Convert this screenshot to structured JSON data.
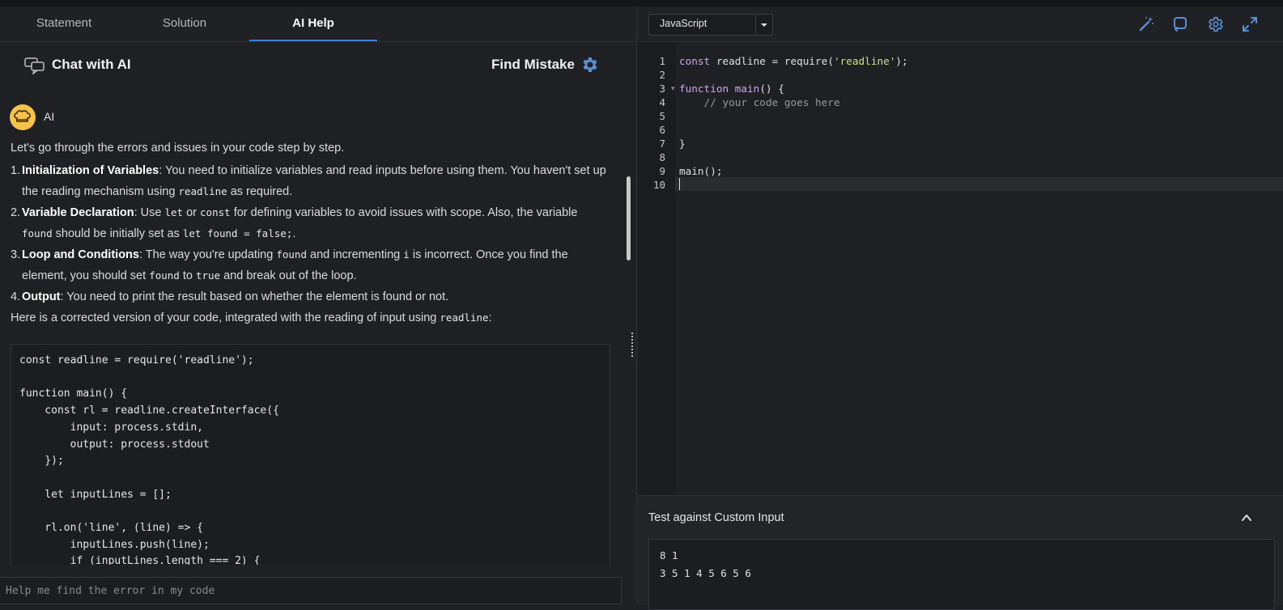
{
  "tabs": [
    {
      "label": "Statement"
    },
    {
      "label": "Solution"
    },
    {
      "label": "AI Help"
    }
  ],
  "chat": {
    "title": "Chat with AI",
    "find_mistake": "Find Mistake",
    "sender": "AI",
    "intro": "Let's go through the errors and issues in your code step by step.",
    "items": [
      {
        "num": "1.",
        "title": "Initialization of Variables",
        "t1": ": You need to initialize variables and read inputs before using them. You haven't set up the reading mechanism using ",
        "c1": "readline",
        "t2": " as required."
      },
      {
        "num": "2.",
        "title": "Variable Declaration",
        "t1": ": Use ",
        "c1": "let",
        "t2": " or ",
        "c2": "const",
        "t3": " for defining variables to avoid issues with scope. Also, the variable ",
        "c3": "found",
        "t4": " should be initially set as ",
        "c4": "let found = false;",
        "t5": "."
      },
      {
        "num": "3.",
        "title": "Loop and Conditions",
        "t1": ": The way you're updating ",
        "c1": "found",
        "t2": " and incrementing ",
        "c2": "i",
        "t3": " is incorrect. Once you find the element, you should set ",
        "c3": "found",
        "t4": " to ",
        "c4": "true",
        "t5": " and break out of the loop."
      },
      {
        "num": "4.",
        "title": "Output",
        "t1": ": You need to print the result based on whether the element is found or not."
      }
    ],
    "corrected_text": "Here is a corrected version of your code, integrated with the reading of input using ",
    "corrected_code": "readline",
    "corrected_colon": ":",
    "code_block": "const readline = require('readline');\n\nfunction main() {\n    const rl = readline.createInterface({\n        input: process.stdin,\n        output: process.stdout\n    });\n\n    let inputLines = [];\n\n    rl.on('line', (line) => {\n        inputLines.push(line);\n        if (inputLines.length === 2) {",
    "input_placeholder": "Help me find the error in my code"
  },
  "editor": {
    "language": "JavaScript",
    "line_numbers": [
      "1",
      "2",
      "3",
      "4",
      "5",
      "6",
      "7",
      "8",
      "9",
      "10"
    ],
    "lines": [
      {
        "t_kw": "const",
        "t_a": " readline = require(",
        "t_str": "'readline'",
        "t_b": ");"
      },
      {},
      {
        "t_kw": "function",
        "t_a": " ",
        "t_fn": "main",
        "t_b": "() {"
      },
      {
        "t_cmt": "    // your code goes here"
      },
      {},
      {},
      {
        "t_a": "}"
      },
      {},
      {
        "t_a": "main();"
      },
      {}
    ]
  },
  "custom_input": {
    "title": "Test against Custom Input",
    "value": "8 1\n3 5 1 4 5 6 5 6"
  },
  "colors": {
    "accent": "#3c7fd6",
    "avatar": "#f5c24a",
    "gear": "#5a8fd0",
    "string": "#cbe085",
    "keyword": "#c9a9e8"
  }
}
